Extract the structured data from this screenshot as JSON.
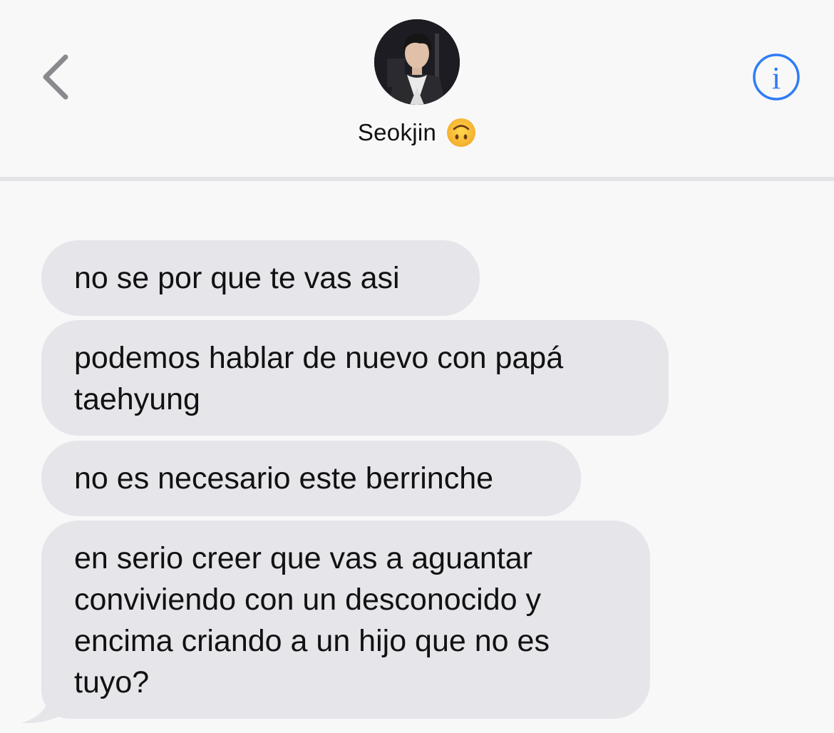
{
  "header": {
    "contact_name": "Seokjin",
    "contact_emoji": "upside-down-face-emoji",
    "back_icon": "chevron-left-icon",
    "info_icon": "info-icon",
    "accent_color": "#2f7cf6"
  },
  "messages": [
    {
      "direction": "incoming",
      "text": "no se por que te vas asi"
    },
    {
      "direction": "incoming",
      "text": "podemos hablar de nuevo con papá\ntaehyung"
    },
    {
      "direction": "incoming",
      "text": "no es necesario este berrinche"
    },
    {
      "direction": "incoming",
      "text": "en serio creer que vas a aguantar\nconviviendo con un desconocido y\nencima criando a un hijo que no es\ntuyo?"
    }
  ],
  "colors": {
    "incoming_bubble": "#e5e5ea",
    "background": "#f8f8f8"
  }
}
